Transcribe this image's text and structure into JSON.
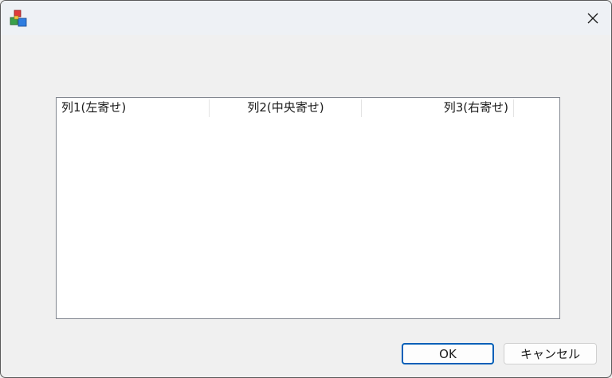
{
  "window": {
    "icon": "app-cubes-icon",
    "close_icon": "close-icon"
  },
  "listview": {
    "columns": [
      {
        "label": "列1(左寄せ)",
        "align": "left"
      },
      {
        "label": "列2(中央寄せ)",
        "align": "center"
      },
      {
        "label": "列3(右寄せ)",
        "align": "right"
      }
    ],
    "rows": []
  },
  "buttons": {
    "ok_label": "OK",
    "cancel_label": "キャンセル"
  },
  "colors": {
    "accent": "#005fb8",
    "background": "#f0f0f0"
  }
}
